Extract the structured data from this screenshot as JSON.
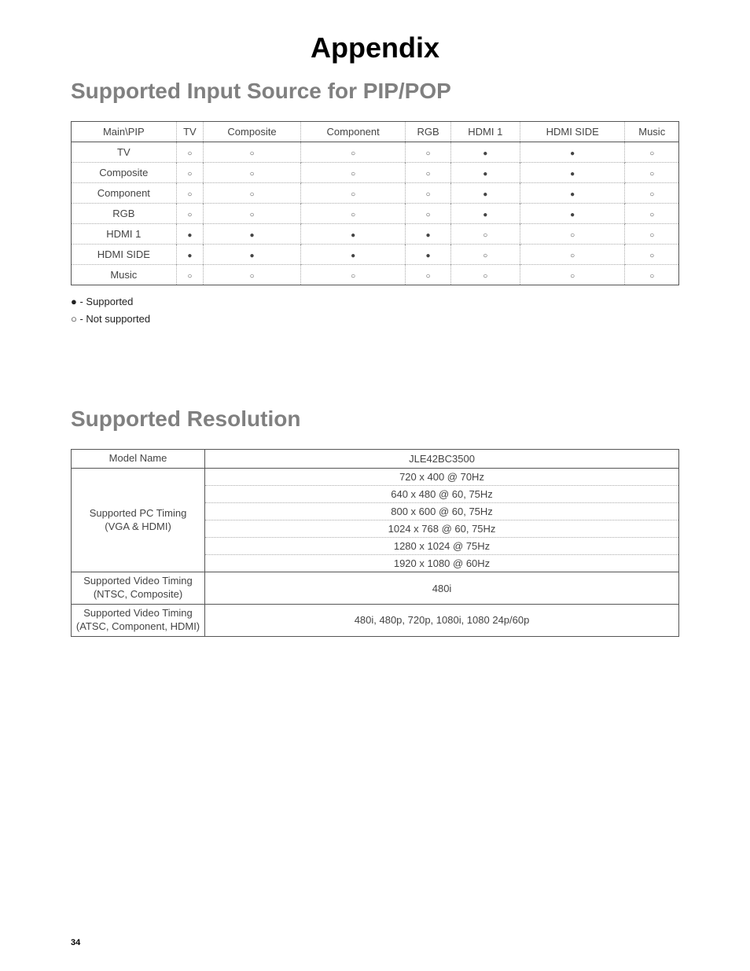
{
  "page": {
    "title": "Appendix",
    "number": "34"
  },
  "pip_section": {
    "heading": "Supported Input Source for PIP/POP",
    "headers": [
      "Main\\PIP",
      "TV",
      "Composite",
      "Component",
      "RGB",
      "HDMI 1",
      "HDMI SIDE",
      "Music"
    ],
    "rows": [
      {
        "label": "TV",
        "cells": [
          "○",
          "○",
          "○",
          "○",
          "●",
          "●",
          "○"
        ]
      },
      {
        "label": "Composite",
        "cells": [
          "○",
          "○",
          "○",
          "○",
          "●",
          "●",
          "○"
        ]
      },
      {
        "label": "Component",
        "cells": [
          "○",
          "○",
          "○",
          "○",
          "●",
          "●",
          "○"
        ]
      },
      {
        "label": "RGB",
        "cells": [
          "○",
          "○",
          "○",
          "○",
          "●",
          "●",
          "○"
        ]
      },
      {
        "label": "HDMI 1",
        "cells": [
          "●",
          "●",
          "●",
          "●",
          "○",
          "○",
          "○"
        ]
      },
      {
        "label": "HDMI SIDE",
        "cells": [
          "●",
          "●",
          "●",
          "●",
          "○",
          "○",
          "○"
        ]
      },
      {
        "label": "Music",
        "cells": [
          "○",
          "○",
          "○",
          "○",
          "○",
          "○",
          "○"
        ]
      }
    ],
    "legend_supported": "● - Supported",
    "legend_not_supported": "○ - Not supported"
  },
  "res_section": {
    "heading": "Supported Resolution",
    "header_left": "Model Name",
    "header_right": "JLE42BC3500",
    "groups": [
      {
        "label": "Supported PC Timing\n(VGA & HDMI)",
        "values": [
          "720 x 400 @ 70Hz",
          "640 x 480 @ 60, 75Hz",
          "800 x 600 @ 60, 75Hz",
          "1024 x 768 @ 60, 75Hz",
          "1280 x 1024 @ 75Hz",
          "1920 x 1080 @ 60Hz"
        ]
      },
      {
        "label": "Supported Video Timing\n(NTSC, Composite)",
        "values": [
          "480i"
        ]
      },
      {
        "label": "Supported Video Timing\n(ATSC, Component, HDMI)",
        "values": [
          "480i, 480p, 720p, 1080i, 1080 24p/60p"
        ]
      }
    ]
  }
}
